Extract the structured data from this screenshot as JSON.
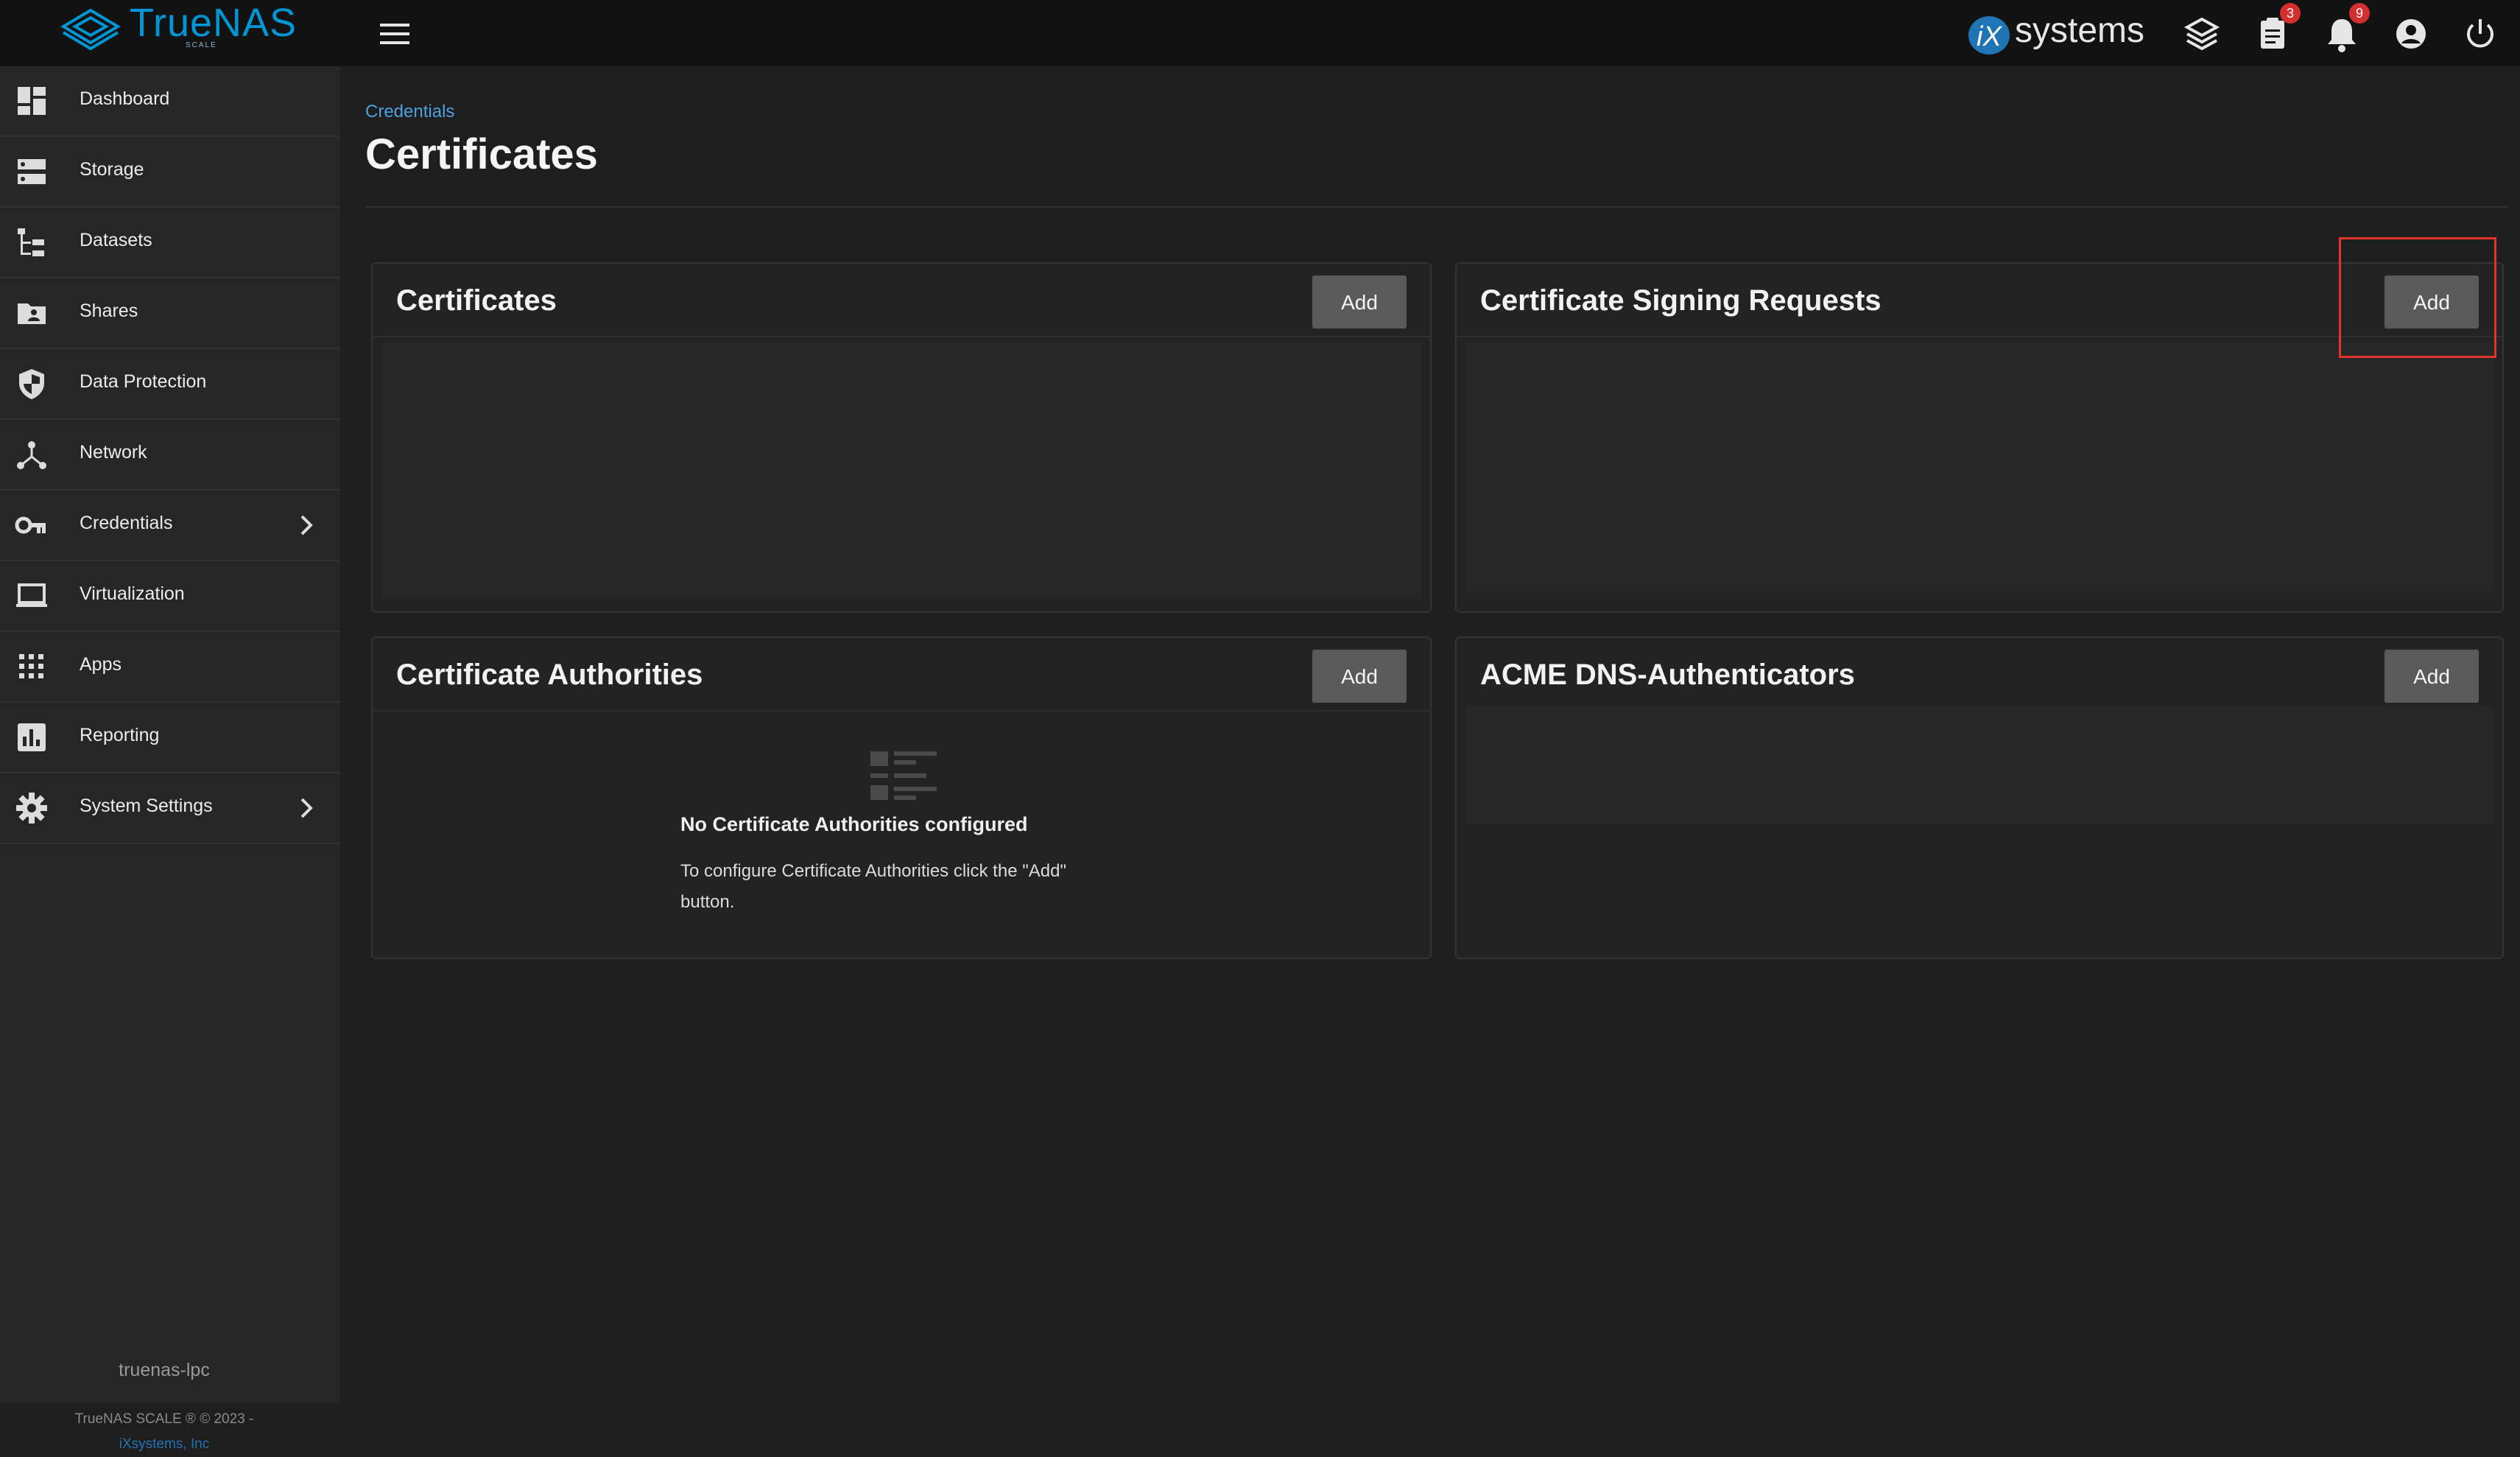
{
  "app": {
    "logo_text": "TrueNAS",
    "logo_subtext": "SCALE",
    "vendor_logo_text": "systems",
    "vendor_logo_mark": "iX"
  },
  "topbar": {
    "menu_icon": "hamburger-menu-icon",
    "icons": [
      {
        "name": "truecommand-icon"
      },
      {
        "name": "jobs-icon",
        "badge": "3"
      },
      {
        "name": "notifications-icon",
        "badge": "9"
      },
      {
        "name": "account-icon"
      },
      {
        "name": "power-icon"
      }
    ]
  },
  "sidebar": {
    "items": [
      {
        "label": "Dashboard",
        "icon": "dashboard-icon"
      },
      {
        "label": "Storage",
        "icon": "storage-icon"
      },
      {
        "label": "Datasets",
        "icon": "datasets-icon"
      },
      {
        "label": "Shares",
        "icon": "shares-icon"
      },
      {
        "label": "Data Protection",
        "icon": "shield-icon"
      },
      {
        "label": "Network",
        "icon": "network-icon"
      },
      {
        "label": "Credentials",
        "icon": "key-icon",
        "has_submenu": true
      },
      {
        "label": "Virtualization",
        "icon": "laptop-icon"
      },
      {
        "label": "Apps",
        "icon": "apps-grid-icon"
      },
      {
        "label": "Reporting",
        "icon": "reporting-icon"
      },
      {
        "label": "System Settings",
        "icon": "gear-icon",
        "has_submenu": true
      }
    ],
    "hostname": "truenas-lpc",
    "copyright": "TrueNAS SCALE ® © 2023 -",
    "company_link": "iXsystems, Inc"
  },
  "main": {
    "breadcrumb": "Credentials",
    "title": "Certificates",
    "cards": {
      "certificates": {
        "title": "Certificates",
        "add_label": "Add"
      },
      "csr": {
        "title": "Certificate Signing Requests",
        "add_label": "Add"
      },
      "authorities": {
        "title": "Certificate Authorities",
        "add_label": "Add",
        "empty_title": "No Certificate Authorities configured",
        "empty_text": "To configure Certificate Authorities click the \"Add\" button."
      },
      "acme": {
        "title": "ACME DNS-Authenticators",
        "add_label": "Add"
      }
    }
  },
  "colors": {
    "topbar_bg": "#121212",
    "sidebar_bg": "#262626",
    "page_bg": "#1e1e1e",
    "brand_blue": "#0095d5",
    "link_blue": "#4aa3df",
    "badge_red": "#d32f2f",
    "highlight_red": "#e0352b"
  }
}
